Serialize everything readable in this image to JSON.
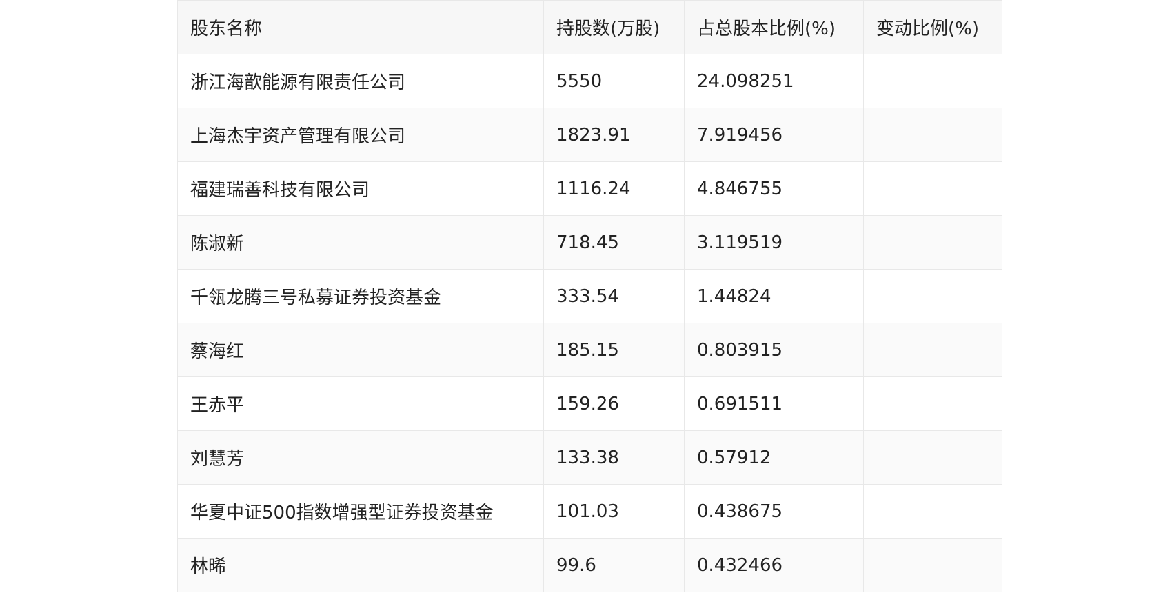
{
  "table": {
    "headers": [
      "股东名称",
      "持股数(万股)",
      "占总股本比例(%)",
      "变动比例(%)"
    ],
    "rows": [
      [
        "浙江海歆能源有限责任公司",
        "5550",
        "24.098251",
        ""
      ],
      [
        "上海杰宇资产管理有限公司",
        "1823.91",
        "7.919456",
        ""
      ],
      [
        "福建瑞善科技有限公司",
        "1116.24",
        "4.846755",
        ""
      ],
      [
        "陈淑新",
        "718.45",
        "3.119519",
        ""
      ],
      [
        "千瓴龙腾三号私募证券投资基金",
        "333.54",
        "1.44824",
        ""
      ],
      [
        "蔡海红",
        "185.15",
        "0.803915",
        ""
      ],
      [
        "王赤平",
        "159.26",
        "0.691511",
        ""
      ],
      [
        "刘慧芳",
        "133.38",
        "0.57912",
        ""
      ],
      [
        "华夏中证500指数增强型证券投资基金",
        "101.03",
        "0.438675",
        ""
      ],
      [
        "林晞",
        "99.6",
        "0.432466",
        ""
      ]
    ]
  }
}
